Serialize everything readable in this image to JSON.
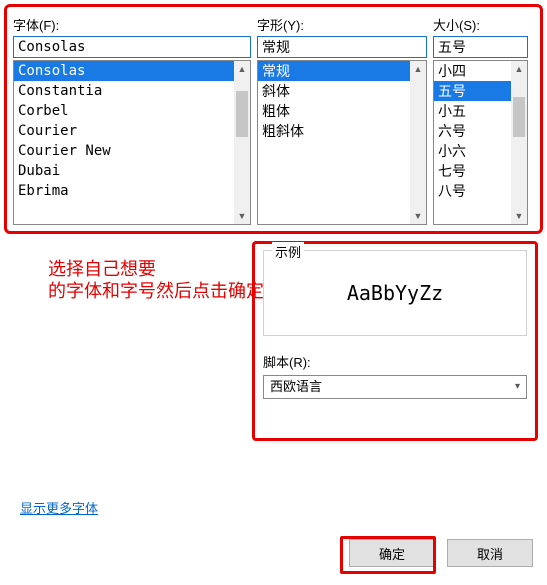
{
  "labels": {
    "font": "字体(F):",
    "style": "字形(Y):",
    "size": "大小(S):",
    "sample": "示例",
    "script": "脚本(R):",
    "more_fonts": "显示更多字体",
    "ok": "确定",
    "cancel": "取消"
  },
  "selected": {
    "font": "Consolas",
    "style": "常规",
    "size": "五号",
    "script": "西欧语言"
  },
  "font_list": [
    "Consolas",
    "Constantia",
    "Corbel",
    "Courier",
    "Courier New",
    "Dubai",
    "Ebrima"
  ],
  "style_list": [
    "常规",
    "斜体",
    "粗体",
    "粗斜体"
  ],
  "size_list": [
    "小四",
    "五号",
    "小五",
    "六号",
    "小六",
    "七号",
    "八号"
  ],
  "sample_text": "AaBbYyZz",
  "annotation": "选择自己想要\n的字体和字号然后点击确定"
}
